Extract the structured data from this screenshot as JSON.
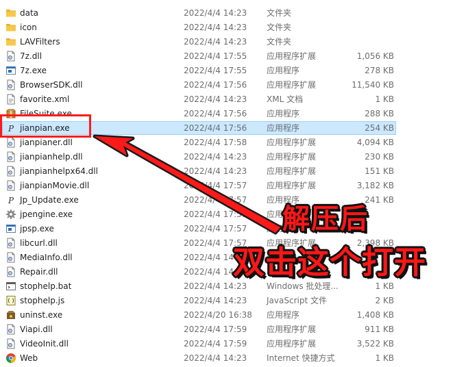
{
  "files": [
    {
      "name": "data",
      "date": "2022/4/4 14:23",
      "type": "文件夹",
      "size": "",
      "icon": "folder-icon"
    },
    {
      "name": "icon",
      "date": "2022/4/4 14:23",
      "type": "文件夹",
      "size": "",
      "icon": "folder-icon"
    },
    {
      "name": "LAVFilters",
      "date": "2022/4/4 14:23",
      "type": "文件夹",
      "size": "",
      "icon": "folder-icon"
    },
    {
      "name": "7z.dll",
      "date": "2022/4/4 17:55",
      "type": "应用程序扩展",
      "size": "1,056 KB",
      "icon": "dll-icon"
    },
    {
      "name": "7z.exe",
      "date": "2022/4/4 17:55",
      "type": "应用程序",
      "size": "278 KB",
      "icon": "exe-window-icon"
    },
    {
      "name": "BrowserSDK.dll",
      "date": "2022/4/4 17:56",
      "type": "应用程序扩展",
      "size": "11,540 KB",
      "icon": "dll-icon"
    },
    {
      "name": "favorite.xml",
      "date": "2022/4/4 14:23",
      "type": "XML 文档",
      "size": "1 KB",
      "icon": "document-icon"
    },
    {
      "name": "FileSuite.exe",
      "date": "2022/4/4 17:56",
      "type": "应用程序",
      "size": "288 KB",
      "icon": "package-icon"
    },
    {
      "name": "jianpian.exe",
      "date": "2022/4/4 17:56",
      "type": "应用程序",
      "size": "254 KB",
      "icon": "jianpian-app-icon"
    },
    {
      "name": "jianpianer.dll",
      "date": "2022/4/4 17:58",
      "type": "应用程序扩展",
      "size": "4,094 KB",
      "icon": "dll-icon"
    },
    {
      "name": "jianpianhelp.dll",
      "date": "2022/4/4 14:23",
      "type": "应用程序扩展",
      "size": "230 KB",
      "icon": "dll-icon"
    },
    {
      "name": "jianpianhelpx64.dll",
      "date": "2022/4/4 14:23",
      "type": "应用程序扩展",
      "size": "151 KB",
      "icon": "dll-icon"
    },
    {
      "name": "jianpianMovie.dll",
      "date": "2022/4/4 17:57",
      "type": "应用程序扩展",
      "size": "3,182 KB",
      "icon": "dll-icon"
    },
    {
      "name": "Jp_Update.exe",
      "date": "2022/4/4 17:57",
      "type": "应用程序",
      "size": "241 KB",
      "icon": "jianpian-app-icon"
    },
    {
      "name": "jpengine.exe",
      "date": "2022/4/4 17:57",
      "type": "应用程序",
      "size": "",
      "icon": "gear-icon"
    },
    {
      "name": "jpsp.exe",
      "date": "2022/4/4 17:57",
      "type": "应用程序",
      "size": "",
      "icon": "exe-window-icon"
    },
    {
      "name": "libcurl.dll",
      "date": "2022/4/4 17:57",
      "type": "应用程序扩展",
      "size": "2,398 KB",
      "icon": "dll-icon"
    },
    {
      "name": "MediaInfo.dll",
      "date": "2022/4/4 14",
      "type": "",
      "size": "",
      "icon": "dll-icon"
    },
    {
      "name": "Repair.dll",
      "date": "2022/4/4 14",
      "type": "",
      "size": "",
      "icon": "dll-icon"
    },
    {
      "name": "stophelp.bat",
      "date": "2022/4/4 14:23",
      "type": "Windows 批处理...",
      "size": "1 KB",
      "icon": "batch-file-icon"
    },
    {
      "name": "stophelp.js",
      "date": "2022/4/4 14:23",
      "type": "JavaScript 文件",
      "size": "2 KB",
      "icon": "script-file-icon"
    },
    {
      "name": "uninst.exe",
      "date": "2022/4/20 16:38",
      "type": "应用程序",
      "size": "1,408 KB",
      "icon": "uninstall-icon"
    },
    {
      "name": "Viapi.dll",
      "date": "2022/4/4 17:59",
      "type": "应用程序扩展",
      "size": "911 KB",
      "icon": "dll-icon"
    },
    {
      "name": "VideoInit.dll",
      "date": "2022/4/4 17:59",
      "type": "应用程序扩展",
      "size": "3,522 KB",
      "icon": "dll-icon"
    },
    {
      "name": "Web",
      "date": "2022/4/4 14:23",
      "type": "Internet 快捷方式",
      "size": "1 KB",
      "icon": "chrome-shortcut-icon"
    }
  ],
  "selected_index": 8,
  "annotation": {
    "line1": "解压后",
    "line2": "双击这个打开",
    "color": "#ff1717"
  },
  "colors": {
    "selection_bg": "#cce8ff",
    "selection_border": "#99d1ff",
    "folder": "#f7c948",
    "secondary_text": "#6d6d6d"
  }
}
